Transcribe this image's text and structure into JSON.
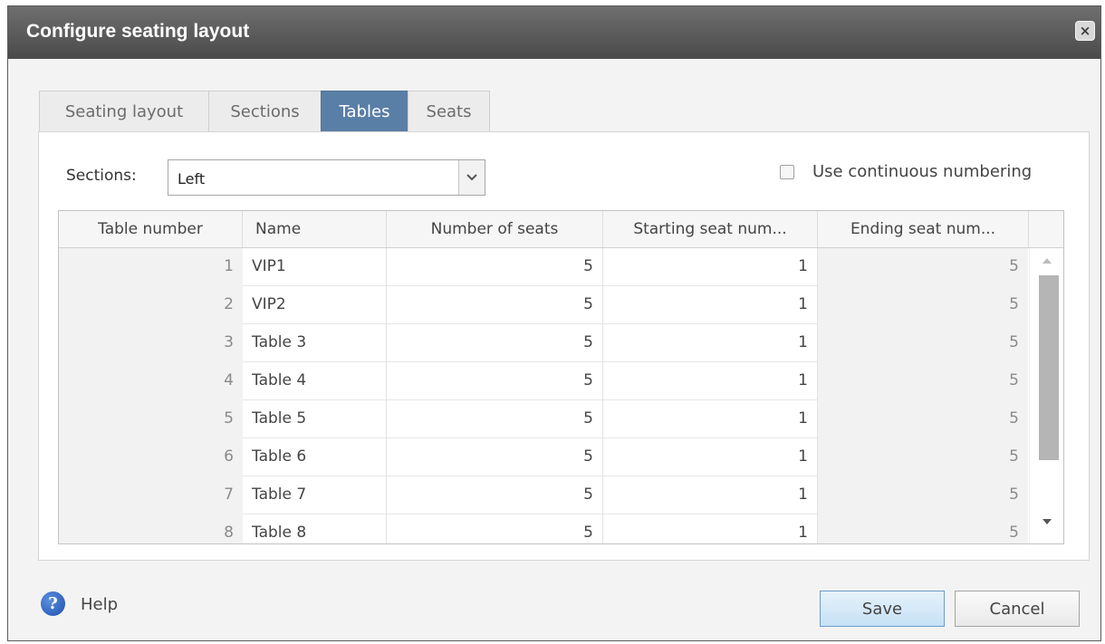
{
  "dialog": {
    "title": "Configure seating layout",
    "close_label": "×"
  },
  "tabs": [
    {
      "label": "Seating layout",
      "active": false
    },
    {
      "label": "Sections",
      "active": false
    },
    {
      "label": "Tables",
      "active": true
    },
    {
      "label": "Seats",
      "active": false
    }
  ],
  "filters": {
    "sections_label": "Sections:",
    "sections_value": "Left",
    "continuous_numbering_label": "Use continuous numbering",
    "continuous_numbering_checked": false
  },
  "table": {
    "headers": [
      "Table number",
      "Name",
      "Number of seats",
      "Starting seat num...",
      "Ending seat num..."
    ],
    "rows": [
      {
        "number": "1",
        "name": "VIP1",
        "seats": "5",
        "start": "1",
        "end": "5"
      },
      {
        "number": "2",
        "name": "VIP2",
        "seats": "5",
        "start": "1",
        "end": "5"
      },
      {
        "number": "3",
        "name": "Table 3",
        "seats": "5",
        "start": "1",
        "end": "5"
      },
      {
        "number": "4",
        "name": "Table 4",
        "seats": "5",
        "start": "1",
        "end": "5"
      },
      {
        "number": "5",
        "name": "Table 5",
        "seats": "5",
        "start": "1",
        "end": "5"
      },
      {
        "number": "6",
        "name": "Table 6",
        "seats": "5",
        "start": "1",
        "end": "5"
      },
      {
        "number": "7",
        "name": "Table 7",
        "seats": "5",
        "start": "1",
        "end": "5"
      },
      {
        "number": "8",
        "name": "Table 8",
        "seats": "5",
        "start": "1",
        "end": "5"
      }
    ]
  },
  "footer": {
    "help_label": "Help",
    "save_label": "Save",
    "cancel_label": "Cancel"
  },
  "icons": {
    "close": "close-icon",
    "help": "help-icon",
    "dropdown": "chevron-down-icon",
    "scroll_up": "arrow-up-icon",
    "scroll_down": "arrow-down-icon"
  },
  "colors": {
    "titlebar": "#4a4a4a",
    "active_tab": "#5a7fa6",
    "save_button_border": "#6d9cc8"
  }
}
